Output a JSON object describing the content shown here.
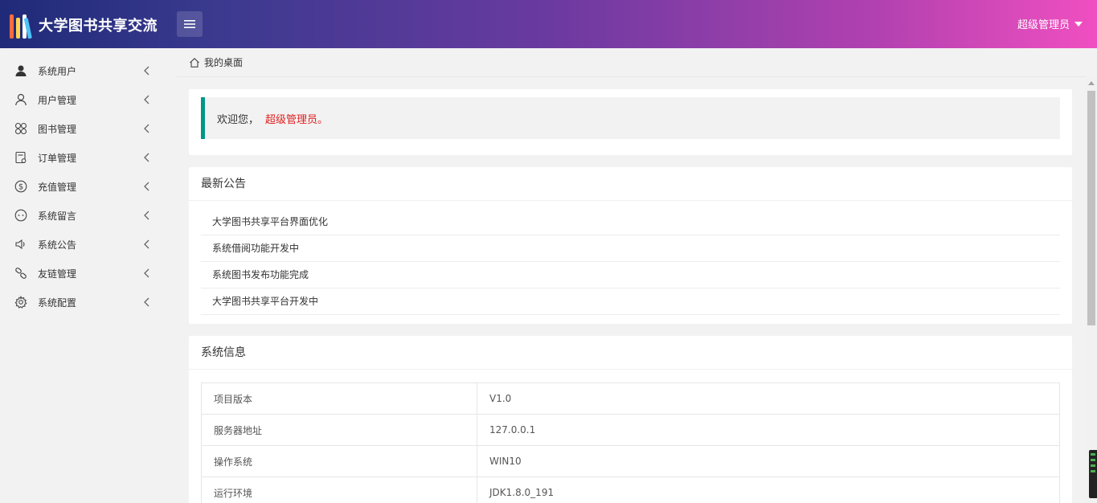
{
  "header": {
    "title": "大学图书共享交流",
    "user_label": "超级管理员",
    "colors": {
      "gradient_start": "#1f2a78",
      "gradient_end": "#f04fc0"
    }
  },
  "sidebar": {
    "items": [
      {
        "label": "系统用户",
        "icon": "person-filled-icon"
      },
      {
        "label": "用户管理",
        "icon": "user-outline-icon"
      },
      {
        "label": "图书管理",
        "icon": "clover-icon"
      },
      {
        "label": "订单管理",
        "icon": "order-icon"
      },
      {
        "label": "充值管理",
        "icon": "dollar-circle-icon"
      },
      {
        "label": "系统留言",
        "icon": "message-face-icon"
      },
      {
        "label": "系统公告",
        "icon": "speaker-icon"
      },
      {
        "label": "友链管理",
        "icon": "link-icon"
      },
      {
        "label": "系统配置",
        "icon": "gear-icon"
      }
    ]
  },
  "breadcrumb": {
    "label": "我的桌面"
  },
  "welcome": {
    "prefix": "欢迎您，",
    "name": "超级管理员。",
    "accent": "#009688",
    "name_color": "#e02020"
  },
  "notices": {
    "title": "最新公告",
    "items": [
      "大学图书共享平台界面优化",
      "系统借阅功能开发中",
      "系统图书发布功能完成",
      "大学图书共享平台开发中"
    ]
  },
  "sysinfo": {
    "title": "系统信息",
    "rows": [
      {
        "key": "项目版本",
        "value": "V1.0"
      },
      {
        "key": "服务器地址",
        "value": "127.0.0.1"
      },
      {
        "key": "操作系统",
        "value": "WIN10"
      },
      {
        "key": "运行环境",
        "value": "JDK1.8.0_191"
      }
    ]
  }
}
